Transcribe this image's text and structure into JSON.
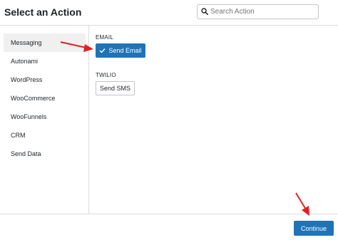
{
  "header": {
    "title": "Select an Action",
    "search_placeholder": "Search Action"
  },
  "sidebar": {
    "items": [
      {
        "label": "Messaging",
        "active": true
      },
      {
        "label": "Autonami"
      },
      {
        "label": "WordPress"
      },
      {
        "label": "WooCommerce"
      },
      {
        "label": "WooFunnels"
      },
      {
        "label": "CRM"
      },
      {
        "label": "Send Data"
      }
    ]
  },
  "content": {
    "groups": [
      {
        "label": "EMAIL",
        "action": "Send Email",
        "selected": true
      },
      {
        "label": "TWILIO",
        "action": "Send SMS",
        "selected": false
      }
    ]
  },
  "footer": {
    "continue_label": "Continue"
  },
  "colors": {
    "primary": "#1f73b7",
    "annotation_arrow": "#e02020",
    "active_sidebar_bg": "#f0f0f1"
  }
}
